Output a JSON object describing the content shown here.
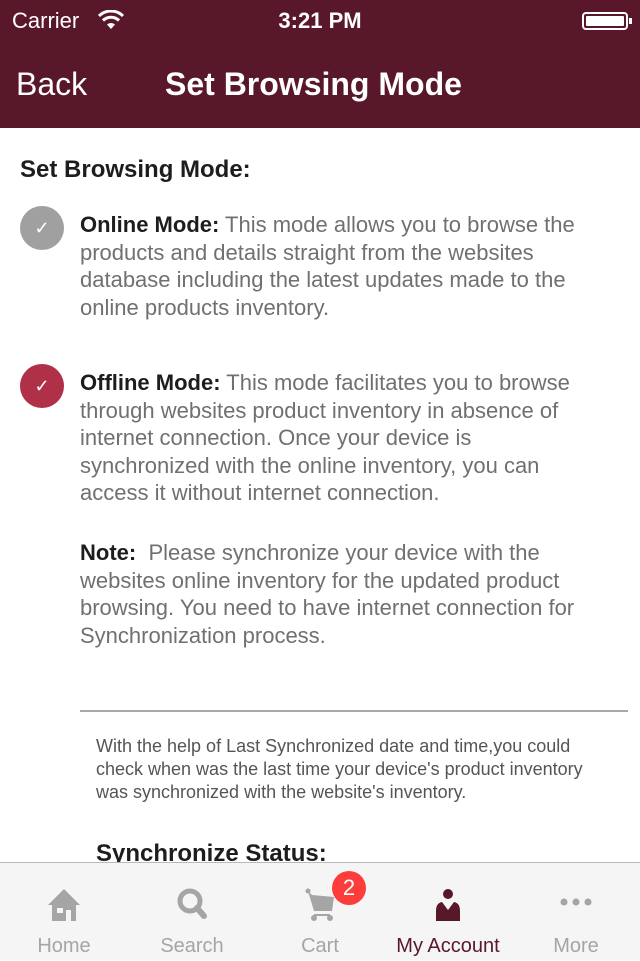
{
  "status_bar": {
    "carrier": "Carrier",
    "time": "3:21 PM"
  },
  "nav": {
    "back_label": "Back",
    "title": "Set Browsing Mode"
  },
  "heading": "Set Browsing Mode:",
  "modes": [
    {
      "label": "Online Mode:",
      "description": "This mode allows you to browse the products and details straight from the websites database including the latest updates made to the online products inventory.",
      "selected": false,
      "color": "#a0a0a0"
    },
    {
      "label": "Offline Mode:",
      "description": "This mode facilitates you to browse through websites product inventory in absence of internet connection. Once your device is synchronized with the online inventory, you can access it without internet connection.",
      "selected": true,
      "color": "#b03048"
    }
  ],
  "note": {
    "label": "Note:",
    "text": "Please synchronize your device with the websites online inventory for the updated product browsing. You need to have internet connection for Synchronization process."
  },
  "info_text": "With the help of Last Synchronized date and time,you could check when was the last time your device's product inventory was synchronized with the website's inventory.",
  "sync_status_label": "Synchronize Status:",
  "tabs": [
    {
      "label": "Home",
      "icon": "home-icon"
    },
    {
      "label": "Search",
      "icon": "search-icon"
    },
    {
      "label": "Cart",
      "icon": "cart-icon",
      "badge": "2"
    },
    {
      "label": "My Account",
      "icon": "person-icon",
      "active": true
    },
    {
      "label": "More",
      "icon": "more-icon"
    }
  ],
  "colors": {
    "brand": "#59172a",
    "badge": "#fc3d39"
  }
}
